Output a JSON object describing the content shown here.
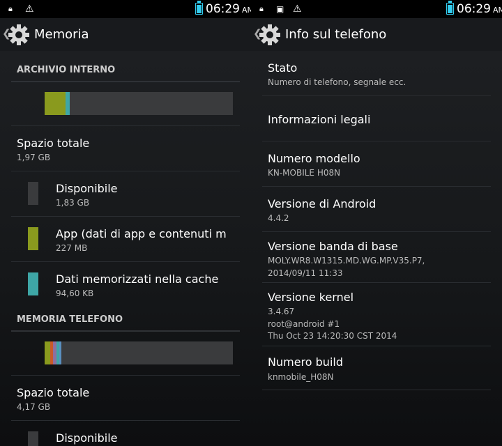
{
  "left": {
    "status_time": "06:29",
    "status_ampm": "AM",
    "title": "Memoria",
    "internal": {
      "header": "ARCHIVIO INTERNO",
      "bar": [
        {
          "fraction": 0.112,
          "color": "#8a9a1e"
        },
        {
          "fraction": 0.024,
          "color": "#3ea6a6"
        }
      ],
      "total_label": "Spazio totale",
      "total_value": "1,97 GB",
      "items": [
        {
          "label": "Disponibile",
          "value": "1,83 GB",
          "color": "#3a3b3d"
        },
        {
          "label": "App (dati di app e contenuti mu",
          "value": "227 MB",
          "color": "#8a9a1e"
        },
        {
          "label": "Dati memorizzati nella cache",
          "value": "94,60 KB",
          "color": "#3ea6a6"
        }
      ]
    },
    "phone": {
      "header": "MEMORIA TELEFONO",
      "bar": [
        {
          "fraction": 0.03,
          "color": "#8a9a1e"
        },
        {
          "fraction": 0.015,
          "color": "#c85a2a"
        },
        {
          "fraction": 0.02,
          "color": "#8f6f9f"
        },
        {
          "fraction": 0.015,
          "color": "#3ea6a6"
        },
        {
          "fraction": 0.01,
          "color": "#5a8fbf"
        }
      ],
      "total_label": "Spazio totale",
      "total_value": "4,17 GB",
      "items": [
        {
          "label": "Disponibile",
          "color": "#3a3b3d"
        }
      ]
    }
  },
  "right": {
    "status_time": "06:29",
    "status_ampm": "AM",
    "title": "Info sul telefono",
    "items": [
      {
        "title": "Stato",
        "sub": "Numero di telefono, segnale ecc."
      },
      {
        "title": "Informazioni legali",
        "sub": ""
      },
      {
        "title": "Numero modello",
        "sub": "KN-MOBILE H08N"
      },
      {
        "title": "Versione di Android",
        "sub": "4.4.2"
      },
      {
        "title": "Versione banda di base",
        "sub_lines": [
          "MOLY.WR8.W1315.MD.WG.MP.V35.P7,",
          "2014/09/11 11:33"
        ]
      },
      {
        "title": "Versione kernel",
        "sub_lines": [
          "3.4.67",
          "root@android #1",
          "Thu Oct 23 14:20:30 CST 2014"
        ]
      },
      {
        "title": "Numero build",
        "sub": "knmobile_H08N"
      }
    ]
  },
  "colors": {
    "accent": "#33ccee",
    "background": "#1a1c1f"
  },
  "icons": [
    "lock-icon",
    "warning-icon",
    "image-icon",
    "battery-icon",
    "settings-gear-icon",
    "up-caret-icon"
  ]
}
